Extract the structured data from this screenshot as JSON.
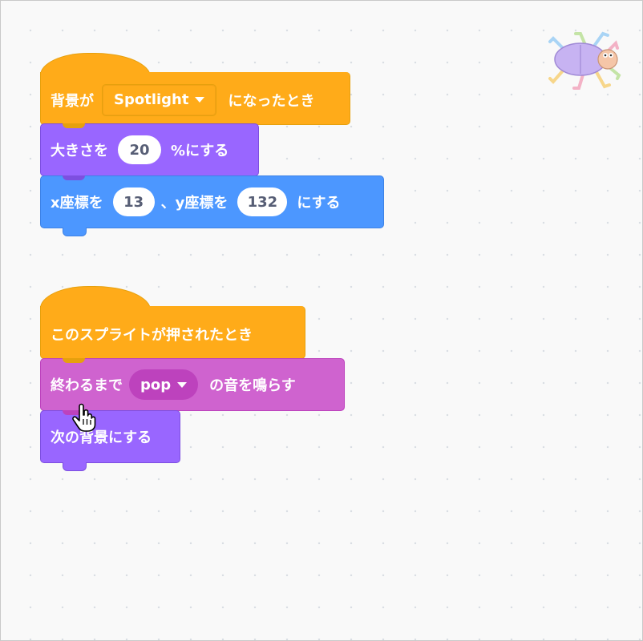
{
  "colors": {
    "events": "#FFAB19",
    "events_dark": "#E6A00D",
    "looks": "#9966FF",
    "motion": "#4C97FF",
    "sound": "#CF63CF",
    "sound_dark": "#BD42BD"
  },
  "icons": {
    "sprite": "ladybug-sprite-icon",
    "cursor": "hand-cursor-icon"
  },
  "script1": {
    "when_backdrop": {
      "prefix": "背景が",
      "backdrop": "Spotlight",
      "suffix": "になったとき"
    },
    "set_size": {
      "prefix": "大きさを",
      "value": "20",
      "suffix": "%にする"
    },
    "go_to_xy": {
      "prefix": "x座標を",
      "x": "13",
      "middle": "、y座標を",
      "y": "132",
      "suffix": "にする"
    }
  },
  "script2": {
    "when_clicked": {
      "label": "このスプライトが押されたとき"
    },
    "play_sound": {
      "prefix": "終わるまで",
      "sound": "pop",
      "suffix": "の音を鳴らす"
    },
    "next_backdrop": {
      "label": "次の背景にする"
    }
  }
}
